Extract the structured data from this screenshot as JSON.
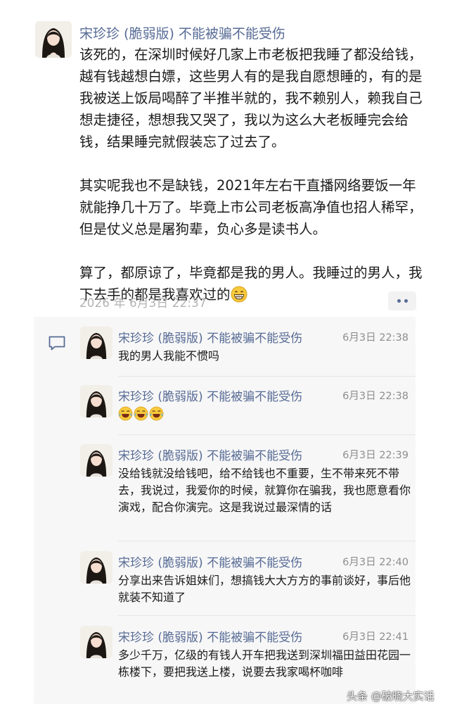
{
  "post": {
    "author": "宋珍珍 (脆弱版) 不能被骗不能受伤",
    "paragraph1": "该死的，在深圳时候好几家上市老板把我睡了都没给钱，越有钱越想白嫖，这些男人有的是我自愿想睡的，有的是我被送上饭局喝醉了半推半就的，我不赖别人，赖我自己想走捷径，想想我又哭了，我以为这么大老板睡完会给钱，结果睡完就假装忘了过去了。",
    "paragraph2": "其实呢我也不是缺钱，2021年左右干直播网络要饭一年就能挣几十万了。毕竟上市公司老板高净值也招人稀罕，但是仗义总是屠狗辈，负心多是读书人。",
    "paragraph3": "算了，都原谅了，毕竟都是我的男人。我睡过的男人，我下去手的都是我喜欢过的",
    "timestamp": "2026 年 6月3日 22:37",
    "more_icon": "more-dots-icon"
  },
  "comments": {
    "items": [
      {
        "author": "宋珍珍 (脆弱版) 不能被骗不能受伤",
        "time": "6月3日  22:38",
        "text": "我的男人我能不惯吗"
      },
      {
        "author": "宋珍珍 (脆弱版) 不能被骗不能受伤",
        "time": "6月3日  22:38",
        "text": ""
      },
      {
        "author": "宋珍珍 (脆弱版) 不能被骗不能受伤",
        "time": "6月3日  22:39",
        "text": "没给钱就没给钱吧，给不给钱也不重要，生不带来死不带去，我说过，我爱你的时候，就算你在骗我，我也愿意看你演戏，配合你演完。这是我说过最深情的话"
      },
      {
        "author": "宋珍珍 (脆弱版) 不能被骗不能受伤",
        "time": "6月3日  22:40",
        "text": "分享出来告诉姐妹们，想搞钱大大方方的事前谈好，事后他就装不知道了"
      },
      {
        "author": "宋珍珍 (脆弱版) 不能被骗不能受伤",
        "time": "6月3日  22:41",
        "text": "多少千万，亿级的有钱人开车把我送到深圳福田益田花园一栋楼下，要把我送上楼，说要去我家喝杯咖啡"
      }
    ]
  },
  "watermark": "头条 @破晓大实话",
  "colors": {
    "name_blue": "#576b95",
    "time_gray": "#b2b2b2",
    "comment_bg": "#f7f7f7"
  }
}
